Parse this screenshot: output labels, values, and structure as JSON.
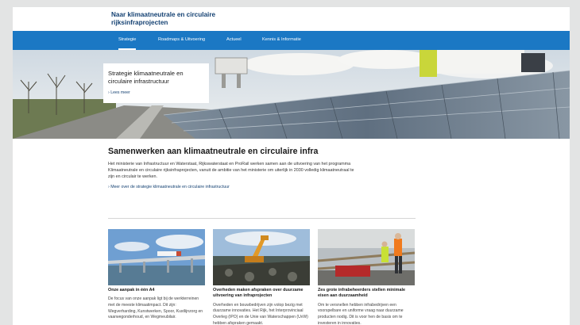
{
  "header": {
    "site_title": "Naar klimaatneutrale en circulaire rijksinfraprojecten"
  },
  "nav": {
    "items": [
      {
        "label": "Strategie",
        "active": true
      },
      {
        "label": "Roadmaps & Uitvoering"
      },
      {
        "label": "Actueel"
      },
      {
        "label": "Kennis & Informatie"
      }
    ]
  },
  "hero": {
    "title": "Strategie klimaatneutrale en circulaire infrastructuur",
    "link": "Lees meer"
  },
  "intro": {
    "heading": "Samenwerken aan klimaatneutrale en circulaire infra",
    "body": "Het ministerie van Infrastructuur en Waterstaat, Rijkswaterstaat en ProRail werken samen aan de uitvoering van het programma Klimaatneutrale en circulaire rijksinfraprojecten, vanuit de ambitie van het ministerie om uiterlijk in 2030 volledig klimaatneutraal te zijn en circulair te werken.",
    "link": "Meer over de strategie klimaatneutrale en circulaire infrastructuur"
  },
  "cards": [
    {
      "title": "Onze aanpak in één A4",
      "text": "De focus van onze aanpak ligt bij de werkterreinen met de meeste klimaatimpact. Dit zijn: Wegverharding, Kunstwerken, Spoor, Kustlijnzorg en vaarwegonderhoud, en Wegmeubilair."
    },
    {
      "title": "Overheden maken afspraken over duurzame uitvoering van infraprojecten",
      "text": "Overheden en bouwbedrijven zijn volop bezig met duurzame innovaties. Het Rijk, het Interprovinciaal Overleg (IPO) en de Unie van Waterschappen (UvW) hebben afspraken gemaakt."
    },
    {
      "title": "Zes grote infrabeheerders stellen minimale eisen aan duurzaamheid",
      "text": "Om te versnellen hebben infrabedrijven een voorspelbare en uniforme vraag naar duurzame producten nodig. Dit is voor hen de basis om te investeren in innovaties."
    }
  ],
  "colors": {
    "nav_bar": "#1b78c4",
    "brand_text": "#154273",
    "page_background": "#e3e4e4"
  }
}
